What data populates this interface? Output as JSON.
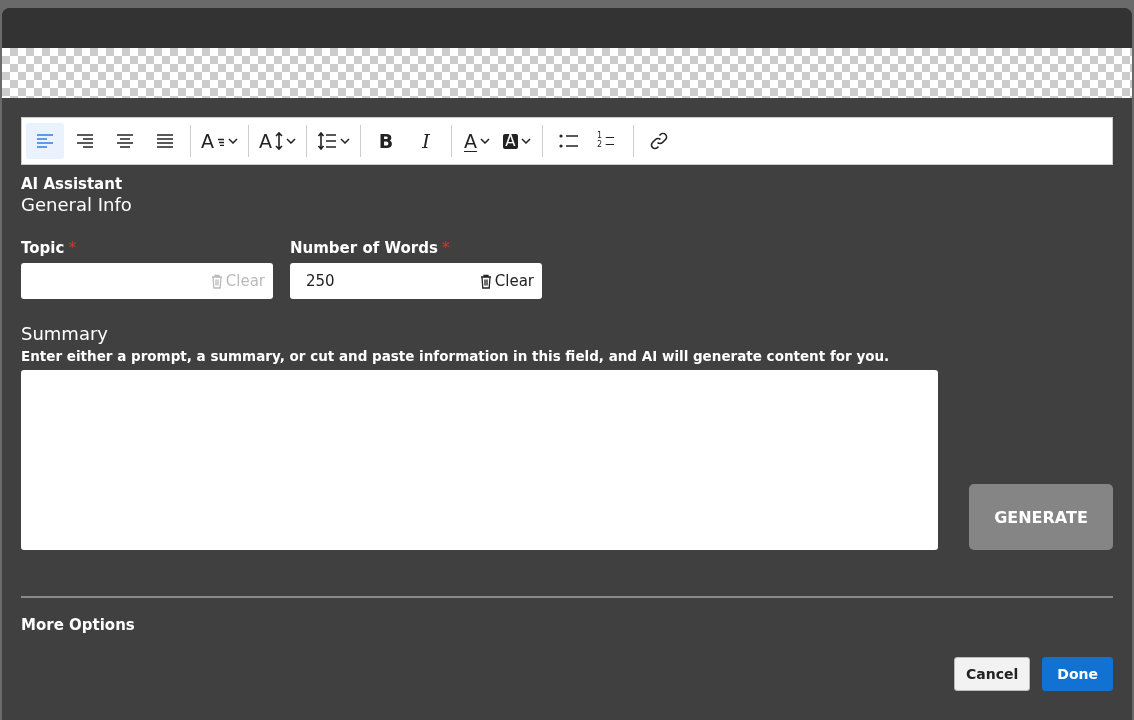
{
  "toolbar": {
    "groups": [
      [
        {
          "kind": "align-left",
          "selected": true
        },
        {
          "kind": "align-right",
          "selected": false
        },
        {
          "kind": "align-center",
          "selected": false
        },
        {
          "kind": "align-justify",
          "selected": false
        }
      ],
      [
        {
          "kind": "font-family",
          "glyph": "A",
          "selected": false,
          "dropdown": true
        }
      ],
      [
        {
          "kind": "font-size",
          "glyph": "A",
          "selected": false,
          "dropdown": true
        }
      ],
      [
        {
          "kind": "line-height",
          "selected": false,
          "dropdown": true
        }
      ],
      [
        {
          "kind": "bold",
          "glyph": "B",
          "selected": false
        },
        {
          "kind": "italic",
          "glyph": "I",
          "selected": false
        }
      ],
      [
        {
          "kind": "font-color",
          "glyph": "A",
          "selected": false,
          "dropdown": true
        },
        {
          "kind": "highlight",
          "glyph": "A",
          "selected": false,
          "dropdown": true
        }
      ],
      [
        {
          "kind": "bullet-list",
          "selected": false
        },
        {
          "kind": "numbered-list",
          "glyph": "1",
          "glyph2": "2",
          "selected": false
        }
      ],
      [
        {
          "kind": "link",
          "selected": false
        }
      ]
    ]
  },
  "panel_title": "AI Assistant",
  "section_title": "General Info",
  "fields": [
    {
      "label": "Topic",
      "required": "*",
      "clear": "Clear",
      "disabled": true
    },
    {
      "label": "Number of Words",
      "required": "*",
      "value": "250",
      "clear": "Clear",
      "disabled": false
    }
  ],
  "summary": {
    "title": "Summary",
    "hint": "Enter either a prompt, a summary, or cut and paste information in this field, and AI will generate content for you."
  },
  "generate_button": "GENERATE",
  "more_options": "More Options",
  "buttons": [
    {
      "label": "Cancel",
      "kind": "secondary"
    },
    {
      "label": "Done",
      "kind": "primary"
    }
  ]
}
